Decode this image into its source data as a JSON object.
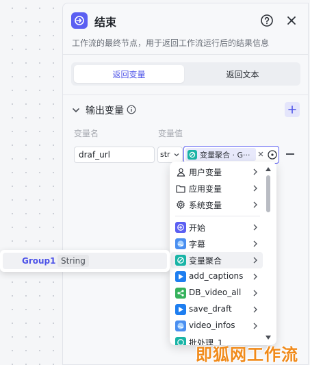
{
  "panel": {
    "title": "结束",
    "description": "工作流的最终节点，用于返回工作流运行后的结果信息",
    "icons": {
      "node": "end-node-icon",
      "help": "help-icon",
      "close": "close-icon"
    },
    "accent_color": "#5b5ff2"
  },
  "tabs": [
    {
      "label": "返回变量",
      "active": true
    },
    {
      "label": "返回文本",
      "active": false
    }
  ],
  "output_section": {
    "title": "输出变量",
    "column_name": "变量名",
    "column_value": "变量值",
    "variable_name": "draf_url",
    "variable_type": "str",
    "reference_label": "变量聚合 · G···"
  },
  "dropdown": {
    "items": [
      {
        "label": "用户变量",
        "icon": "user-icon"
      },
      {
        "label": "应用变量",
        "icon": "folder-icon"
      },
      {
        "label": "系统变量",
        "icon": "gear-icon"
      },
      {
        "label": "开始",
        "icon": "start-node-icon"
      },
      {
        "label": "字幕",
        "icon": "subtitle-node-icon"
      },
      {
        "label": "变量聚合",
        "icon": "aggregate-node-icon"
      },
      {
        "label": "add_captions",
        "icon": "plugin-node-icon"
      },
      {
        "label": "DB_video_all",
        "icon": "db-node-icon"
      },
      {
        "label": "save_draft",
        "icon": "plugin-node-icon"
      },
      {
        "label": "video_infos",
        "icon": "subtitle-node-icon"
      },
      {
        "label": "批处理_1",
        "icon": "aggregate-node-icon"
      }
    ]
  },
  "group_popup": {
    "name": "Group1",
    "type": "String"
  },
  "watermark": "即狐网工作流"
}
